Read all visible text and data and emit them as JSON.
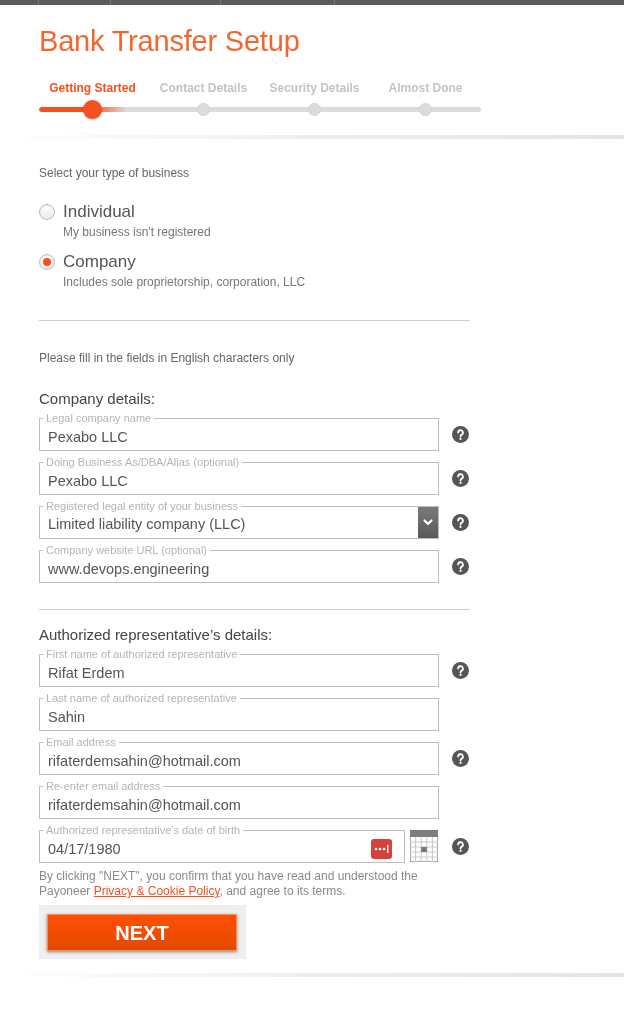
{
  "title": "Bank Transfer Setup",
  "steps": [
    {
      "label": "Getting Started",
      "selected": true
    },
    {
      "label": "Contact Details",
      "selected": false
    },
    {
      "label": "Security Details",
      "selected": false
    },
    {
      "label": "Almost Done",
      "selected": false
    }
  ],
  "business_type": {
    "prompt": "Select your type of business",
    "options": [
      {
        "title": "Individual",
        "description": "My business isn't registered",
        "selected": false
      },
      {
        "title": "Company",
        "description": "Includes sole proprietorship, corporation, LLC",
        "selected": true
      }
    ]
  },
  "note": "Please fill in the fields in English characters only",
  "sections": [
    {
      "heading": "Company details:",
      "fields": [
        {
          "kind": "text",
          "label": "Legal company name",
          "value": "Pexabo LLC",
          "help": true
        },
        {
          "kind": "text",
          "label": "Doing Business As/DBA/Alias (optional)",
          "value": "Pexabo LLC",
          "help": true
        },
        {
          "kind": "select",
          "label": "Registered legal entity of your business",
          "value": "Limited liability company (LLC)",
          "help": true
        },
        {
          "kind": "text",
          "label": "Company website URL (optional)",
          "value": "www.devops.engineering",
          "help": true
        }
      ]
    },
    {
      "heading": "Authorized representative’s details:",
      "fields": [
        {
          "kind": "text",
          "label": "First name of authorized representative",
          "value": "Rifat Erdem",
          "help": true
        },
        {
          "kind": "text",
          "label": "Last name of authorized representative",
          "value": "Sahin",
          "help": false
        },
        {
          "kind": "text",
          "label": "Email address",
          "value": "rifaterdemsahin@hotmail.com",
          "help": true
        },
        {
          "kind": "text",
          "label": "Re-enter email address",
          "value": "rifaterdemsahin@hotmail.com",
          "help": false
        },
        {
          "kind": "date",
          "label": "Authorized representative's date of birth",
          "value": "04/17/1980",
          "help": true
        }
      ]
    }
  ],
  "consent": {
    "before": "By clicking \"NEXT\", you confirm that you have read and understood the Payoneer ",
    "link": "Privacy & Cookie Policy",
    "after": ", and agree to its terms."
  },
  "next_button": {
    "label": "NEXT"
  }
}
